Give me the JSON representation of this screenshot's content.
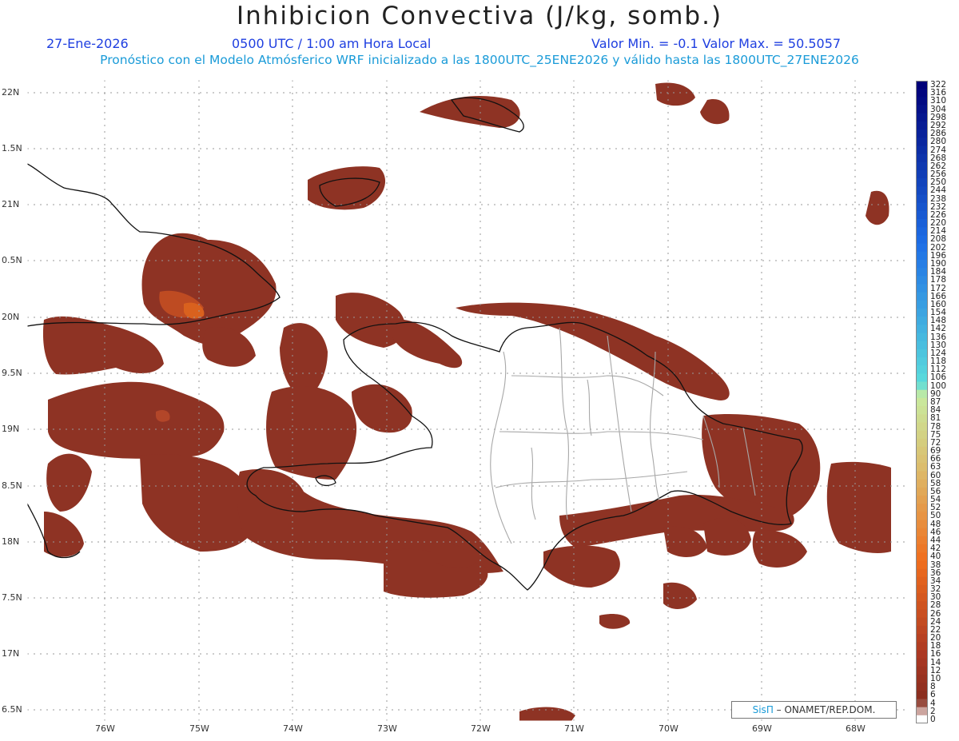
{
  "header": {
    "title": "Inhibicion Convectiva (J/kg, somb.)",
    "date": "27-Ene-2026",
    "time": "0500 UTC / 1:00 am Hora Local",
    "minmax": "Valor Min. = -0.1  Valor Max. = 50.5057",
    "subtitle": "Pronóstico con el Modelo Atmósferico WRF inicializado a las 1800UTC_25ENE2026 y válido hasta las  1800UTC_27ENE2026"
  },
  "axes": {
    "lat_labels": [
      "22N",
      "1.5N",
      "21N",
      "0.5N",
      "20N",
      "9.5N",
      "19N",
      "8.5N",
      "18N",
      "7.5N",
      "17N",
      "6.5N"
    ],
    "lon_labels": [
      "76W",
      "75W",
      "74W",
      "73W",
      "72W",
      "71W",
      "70W",
      "69W",
      "68W"
    ]
  },
  "colorbar": {
    "labels": [
      "322",
      "316",
      "310",
      "304",
      "298",
      "292",
      "286",
      "280",
      "274",
      "268",
      "262",
      "256",
      "250",
      "244",
      "238",
      "232",
      "226",
      "220",
      "214",
      "208",
      "202",
      "196",
      "190",
      "184",
      "178",
      "172",
      "166",
      "160",
      "154",
      "148",
      "142",
      "136",
      "130",
      "124",
      "118",
      "112",
      "106",
      "100",
      "90",
      "87",
      "84",
      "81",
      "78",
      "75",
      "72",
      "69",
      "66",
      "63",
      "60",
      "58",
      "56",
      "54",
      "52",
      "50",
      "48",
      "46",
      "44",
      "42",
      "40",
      "38",
      "36",
      "34",
      "32",
      "30",
      "28",
      "26",
      "24",
      "22",
      "20",
      "18",
      "16",
      "14",
      "12",
      "10",
      "8",
      "6",
      "4",
      "2",
      "0"
    ]
  },
  "credit": {
    "sis": "SisΠ",
    "rest": "– ONAMET/REP.DOM."
  },
  "colors": {
    "cin_fill": "#8e3324",
    "cin_mid": "#a83c22",
    "cin_hot": "#d4571f",
    "coast": "#111111",
    "province_border": "#a8a8a8",
    "grid": "#9a9a9a"
  }
}
